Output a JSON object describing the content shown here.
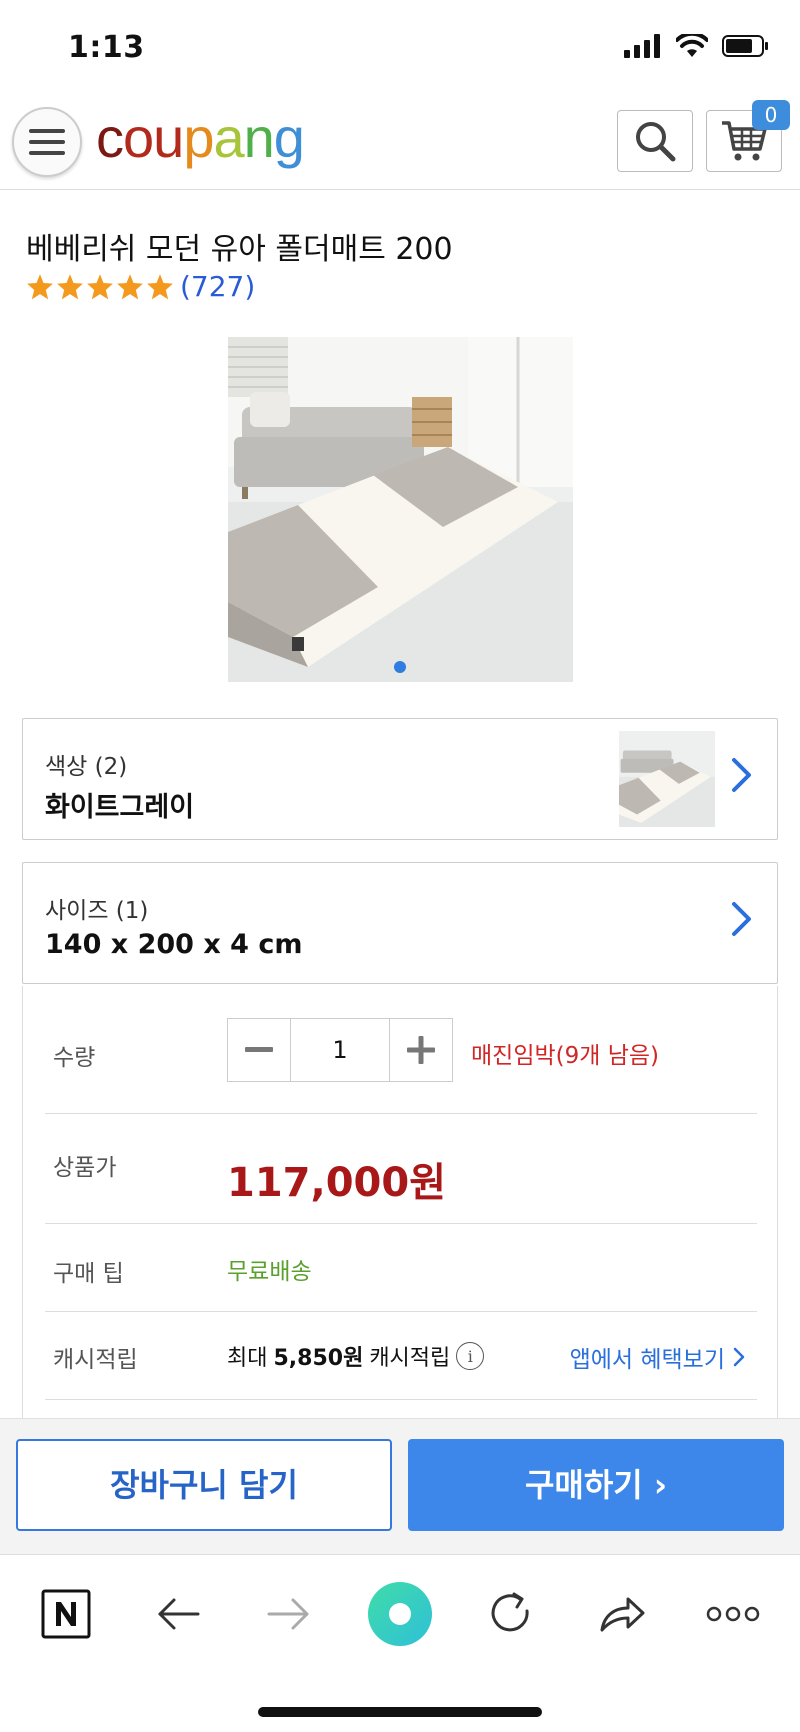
{
  "status_bar": {
    "time": "1:13"
  },
  "header": {
    "logo_letters": [
      "c",
      "o",
      "u",
      "p",
      "a",
      "n",
      "g"
    ],
    "cart_count": "0"
  },
  "product": {
    "title": "베베리쉬 모던 유아 폴더매트 200",
    "rating_stars": 5,
    "review_count": "(727)",
    "image_count_indicator": "1"
  },
  "options": {
    "color": {
      "label": "색상 (2)",
      "value": "화이트그레이"
    },
    "size": {
      "label": "사이즈 (1)",
      "value": "140 x 200 x 4 cm"
    }
  },
  "details": {
    "quantity_label": "수량",
    "quantity_value": "1",
    "stock_warning": "매진임박(9개 남음)",
    "price_label": "상품가",
    "price": "117,000원",
    "tip_label": "구매 팁",
    "tip_value": "무료배송",
    "cash_label": "캐시적립",
    "cash_prefix": "최대",
    "cash_amount": "5,850원",
    "cash_suffix": "캐시적립",
    "benefit_link": "앱에서 혜택보기"
  },
  "actions": {
    "add_to_cart": "장바구니 담기",
    "buy_now": "구매하기 ›"
  },
  "colors": {
    "brand_blue": "#3d87ea",
    "price_red": "#a81818",
    "free_shipping_green": "#5aa02c",
    "star_orange": "#f39a1e"
  },
  "icons": [
    "menu-icon",
    "search-icon",
    "cart-icon",
    "star-icon",
    "chevron-right-icon",
    "minus-icon",
    "plus-icon",
    "info-icon",
    "naver-icon",
    "back-icon",
    "forward-icon",
    "home-icon",
    "reload-icon",
    "share-icon",
    "more-icon"
  ]
}
